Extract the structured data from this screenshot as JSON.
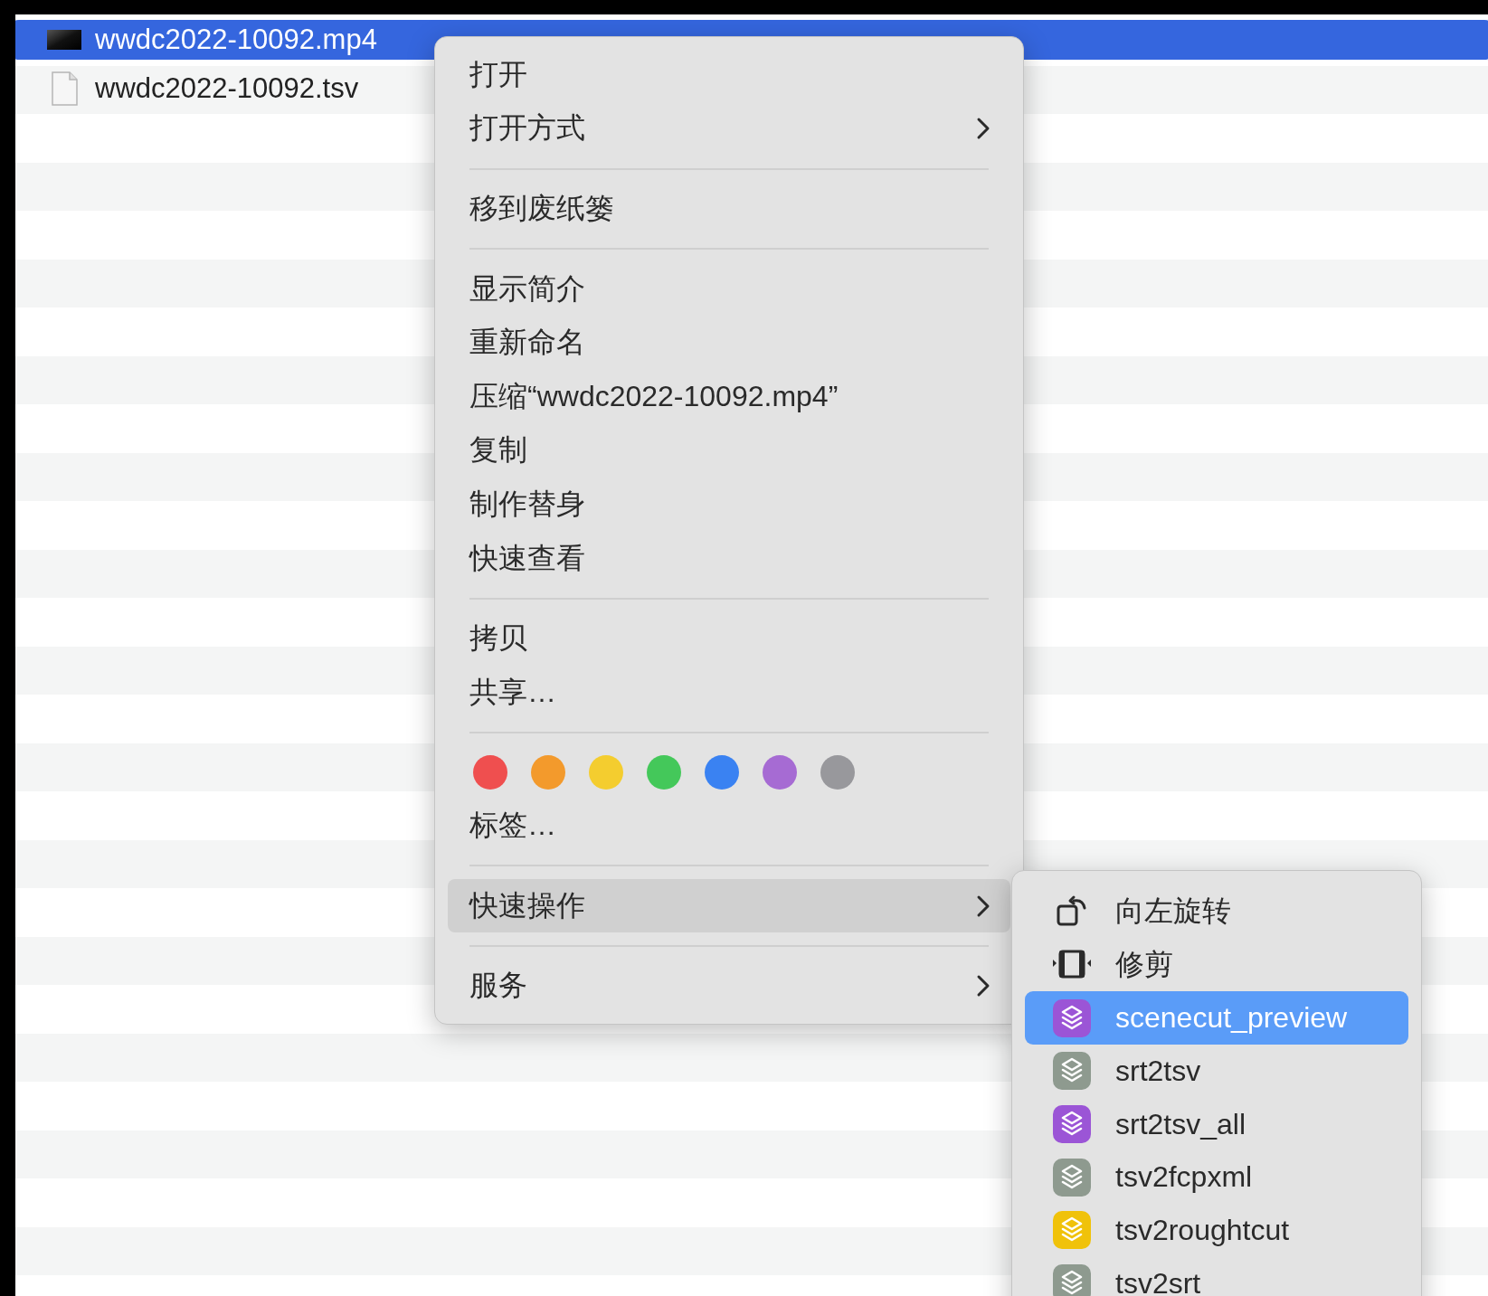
{
  "files": [
    {
      "name": "wwdc2022-10092.mp4",
      "kind": "video",
      "selected": true
    },
    {
      "name": "wwdc2022-10092.tsv",
      "kind": "document",
      "selected": false
    }
  ],
  "context_menu": {
    "sections": [
      {
        "items": [
          {
            "kind": "item",
            "label": "打开",
            "has_submenu": false,
            "highlighted": false
          },
          {
            "kind": "item",
            "label": "打开方式",
            "has_submenu": true,
            "highlighted": false
          }
        ]
      },
      {
        "items": [
          {
            "kind": "item",
            "label": "移到废纸篓",
            "has_submenu": false,
            "highlighted": false
          }
        ]
      },
      {
        "items": [
          {
            "kind": "item",
            "label": "显示简介",
            "has_submenu": false,
            "highlighted": false
          },
          {
            "kind": "item",
            "label": "重新命名",
            "has_submenu": false,
            "highlighted": false
          },
          {
            "kind": "item",
            "label": "压缩“wwdc2022-10092.mp4”",
            "has_submenu": false,
            "highlighted": false
          },
          {
            "kind": "item",
            "label": "复制",
            "has_submenu": false,
            "highlighted": false
          },
          {
            "kind": "item",
            "label": "制作替身",
            "has_submenu": false,
            "highlighted": false
          },
          {
            "kind": "item",
            "label": "快速查看",
            "has_submenu": false,
            "highlighted": false
          }
        ]
      },
      {
        "items": [
          {
            "kind": "item",
            "label": "拷贝",
            "has_submenu": false,
            "highlighted": false
          },
          {
            "kind": "item",
            "label": "共享…",
            "has_submenu": false,
            "highlighted": false
          }
        ]
      },
      {
        "items": [
          {
            "kind": "tags",
            "tags": [
              {
                "color": "#ef4f4f"
              },
              {
                "color": "#f39a2c"
              },
              {
                "color": "#f4cd2f"
              },
              {
                "color": "#44c85a"
              },
              {
                "color": "#3a82f2"
              },
              {
                "color": "#a66bd3"
              },
              {
                "color": "#98989c"
              }
            ]
          },
          {
            "kind": "item",
            "label": "标签…",
            "has_submenu": false,
            "highlighted": false
          }
        ]
      },
      {
        "items": [
          {
            "kind": "item",
            "label": "快速操作",
            "has_submenu": true,
            "highlighted": true
          }
        ]
      },
      {
        "items": [
          {
            "kind": "item",
            "label": "服务",
            "has_submenu": true,
            "highlighted": false
          }
        ]
      }
    ]
  },
  "quick_actions_submenu": {
    "items": [
      {
        "kind": "rotate",
        "label": "向左旋转",
        "selected": false
      },
      {
        "kind": "trim",
        "label": "修剪",
        "selected": false
      },
      {
        "kind": "workflow",
        "color": "#9b55d6",
        "label": "scenecut_preview",
        "selected": true
      },
      {
        "kind": "workflow",
        "color": "#8e9a8f",
        "label": "srt2tsv",
        "selected": false
      },
      {
        "kind": "workflow",
        "color": "#9b55d6",
        "label": "srt2tsv_all",
        "selected": false
      },
      {
        "kind": "workflow",
        "color": "#8e9a8f",
        "label": "tsv2fcpxml",
        "selected": false
      },
      {
        "kind": "workflow",
        "color": "#f0c20a",
        "label": "tsv2roughtcut",
        "selected": false
      },
      {
        "kind": "workflow",
        "color": "#8e9a8f",
        "label": "tsv2srt",
        "selected": false
      }
    ]
  }
}
